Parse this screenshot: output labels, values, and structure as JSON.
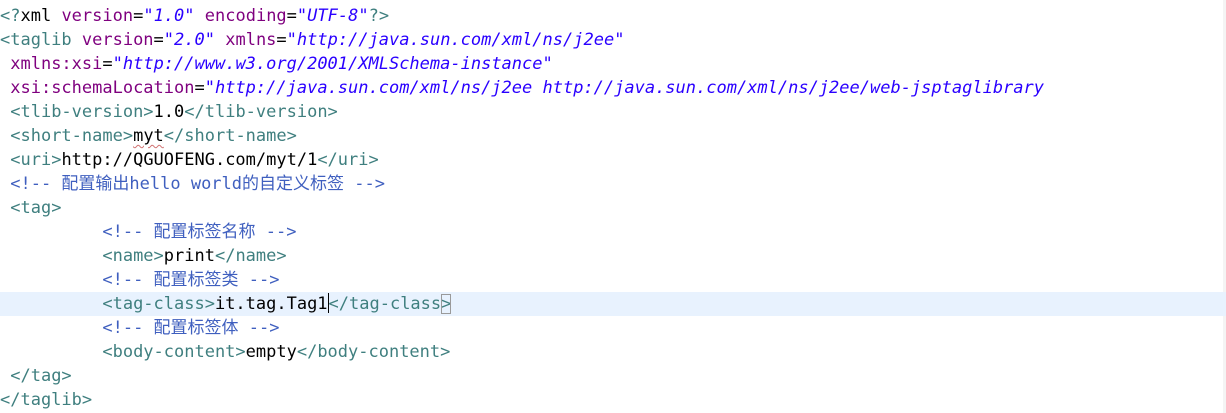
{
  "editor": {
    "lines": [
      {
        "tokens": [
          {
            "c": "tok-tag",
            "t": "<?"
          },
          {
            "c": "tok-decl",
            "t": "xml "
          },
          {
            "c": "tok-attr",
            "t": "version"
          },
          {
            "c": "tok-eq",
            "t": "="
          },
          {
            "c": "tok-val",
            "t": "\"1.0\""
          },
          {
            "c": "tok-decl",
            "t": " "
          },
          {
            "c": "tok-attr",
            "t": "encoding"
          },
          {
            "c": "tok-eq",
            "t": "="
          },
          {
            "c": "tok-val",
            "t": "\"UTF-8\""
          },
          {
            "c": "tok-tag",
            "t": "?>"
          }
        ]
      },
      {
        "tokens": [
          {
            "c": "tok-tag",
            "t": "<taglib "
          },
          {
            "c": "tok-attr",
            "t": "version"
          },
          {
            "c": "tok-eq",
            "t": "="
          },
          {
            "c": "tok-val",
            "t": "\"2.0\""
          },
          {
            "c": "tok-decl",
            "t": " "
          },
          {
            "c": "tok-attr",
            "t": "xmlns"
          },
          {
            "c": "tok-eq",
            "t": "="
          },
          {
            "c": "tok-val",
            "t": "\"http://java.sun.com/xml/ns/j2ee\""
          }
        ]
      },
      {
        "tokens": [
          {
            "c": "tok-decl",
            "t": " "
          },
          {
            "c": "tok-attr",
            "t": "xmlns:xsi"
          },
          {
            "c": "tok-eq",
            "t": "="
          },
          {
            "c": "tok-val",
            "t": "\"http://www.w3.org/2001/XMLSchema-instance\""
          }
        ]
      },
      {
        "tokens": [
          {
            "c": "tok-decl",
            "t": " "
          },
          {
            "c": "tok-attr",
            "t": "xsi:schemaLocation"
          },
          {
            "c": "tok-eq",
            "t": "="
          },
          {
            "c": "tok-val",
            "t": "\"http://java.sun.com/xml/ns/j2ee http://java.sun.com/xml/ns/j2ee/web-jsptaglibrary"
          }
        ]
      },
      {
        "tokens": [
          {
            "c": "tok-decl",
            "t": " "
          },
          {
            "c": "tok-tag",
            "t": "<tlib-version>"
          },
          {
            "c": "tok-text",
            "t": "1.0"
          },
          {
            "c": "tok-tag",
            "t": "</tlib-version>"
          }
        ]
      },
      {
        "tokens": [
          {
            "c": "tok-decl",
            "t": " "
          },
          {
            "c": "tok-tag",
            "t": "<short-name>"
          },
          {
            "c": "tok-text tok-spell",
            "t": "myt"
          },
          {
            "c": "tok-tag",
            "t": "</short-name>"
          }
        ]
      },
      {
        "tokens": [
          {
            "c": "tok-decl",
            "t": " "
          },
          {
            "c": "tok-tag",
            "t": "<uri>"
          },
          {
            "c": "tok-text",
            "t": "http://QGUOFENG.com/myt/1"
          },
          {
            "c": "tok-tag",
            "t": "</uri>"
          }
        ]
      },
      {
        "tokens": [
          {
            "c": "tok-decl",
            "t": " "
          },
          {
            "c": "tok-comment",
            "t": "<!-- 配置输出hello world的自定义标签 -->"
          }
        ]
      },
      {
        "tokens": [
          {
            "c": "tok-decl",
            "t": " "
          },
          {
            "c": "tok-tag",
            "t": "<tag>"
          }
        ]
      },
      {
        "tokens": [
          {
            "c": "tok-decl",
            "t": "          "
          },
          {
            "c": "tok-comment",
            "t": "<!-- 配置标签名称 -->"
          }
        ]
      },
      {
        "tokens": [
          {
            "c": "tok-decl",
            "t": "          "
          },
          {
            "c": "tok-tag",
            "t": "<name>"
          },
          {
            "c": "tok-text",
            "t": "print"
          },
          {
            "c": "tok-tag",
            "t": "</name>"
          }
        ]
      },
      {
        "tokens": [
          {
            "c": "tok-decl",
            "t": "          "
          },
          {
            "c": "tok-comment",
            "t": "<!-- 配置标签类 -->"
          }
        ]
      },
      {
        "current": true,
        "tokens": [
          {
            "c": "tok-decl",
            "t": "          "
          },
          {
            "c": "tok-tag",
            "t": "<tag-class>"
          },
          {
            "c": "tok-text",
            "t": "it.tag.Tag1"
          },
          {
            "c": "caret",
            "t": ""
          },
          {
            "c": "tok-tag",
            "t": "</tag-class"
          },
          {
            "c": "tok-tag bracket-box",
            "t": ">"
          }
        ]
      },
      {
        "tokens": [
          {
            "c": "tok-decl",
            "t": "          "
          },
          {
            "c": "tok-comment",
            "t": "<!-- 配置标签体 -->"
          }
        ]
      },
      {
        "tokens": [
          {
            "c": "tok-decl",
            "t": "          "
          },
          {
            "c": "tok-tag",
            "t": "<body-content>"
          },
          {
            "c": "tok-text",
            "t": "empty"
          },
          {
            "c": "tok-tag",
            "t": "</body-content>"
          }
        ]
      },
      {
        "tokens": [
          {
            "c": "tok-decl",
            "t": " "
          },
          {
            "c": "tok-tag",
            "t": "</tag>"
          }
        ]
      },
      {
        "tokens": [
          {
            "c": "tok-tag",
            "t": "</taglib>"
          }
        ]
      }
    ]
  }
}
